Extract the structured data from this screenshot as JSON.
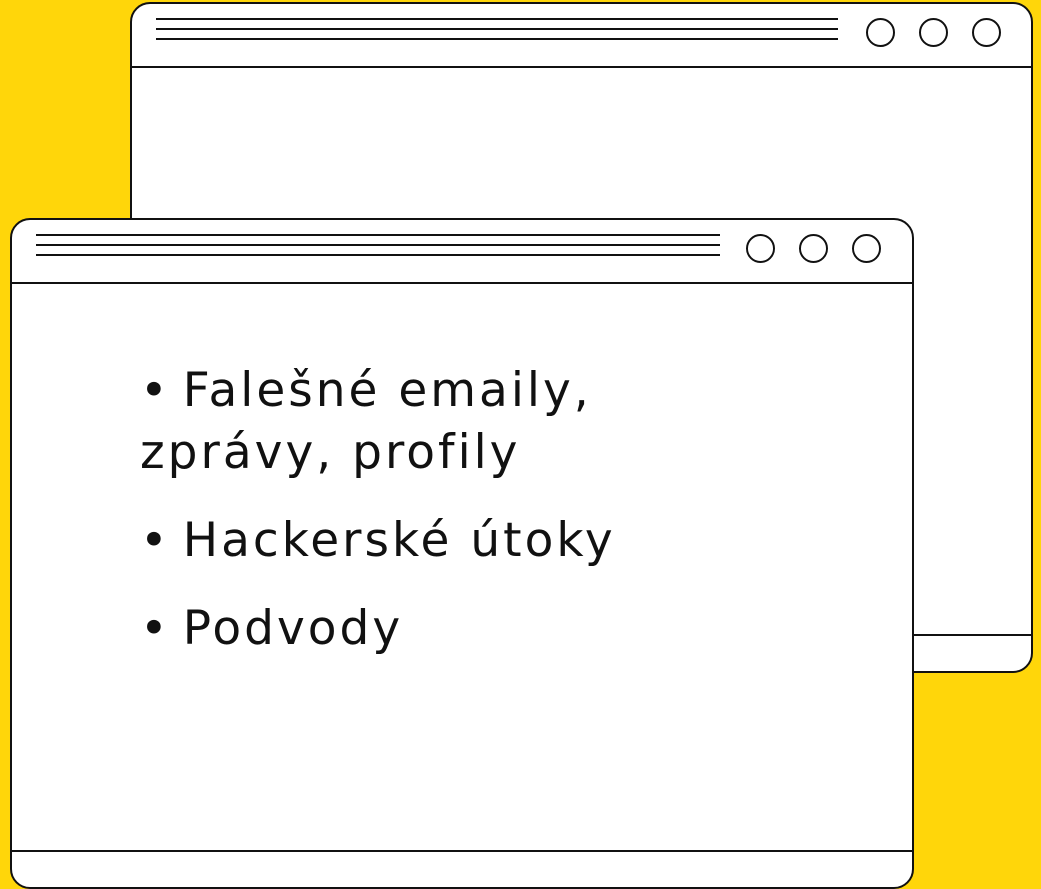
{
  "colors": {
    "background": "#FFD60A",
    "window_fill": "#FFFFFF",
    "outline": "#111111"
  },
  "back_window": {
    "title_bar": {
      "lines": 3,
      "buttons": [
        "circle-button",
        "circle-button",
        "circle-button"
      ]
    }
  },
  "front_window": {
    "title_bar": {
      "lines": 3,
      "buttons": [
        "circle-button",
        "circle-button",
        "circle-button"
      ]
    },
    "list": [
      {
        "bullet": "•",
        "text": "Falešné emaily,\nzprávy, profily"
      },
      {
        "bullet": "•",
        "text": "Hackerské útoky"
      },
      {
        "bullet": "•",
        "text": "Podvody"
      }
    ]
  }
}
